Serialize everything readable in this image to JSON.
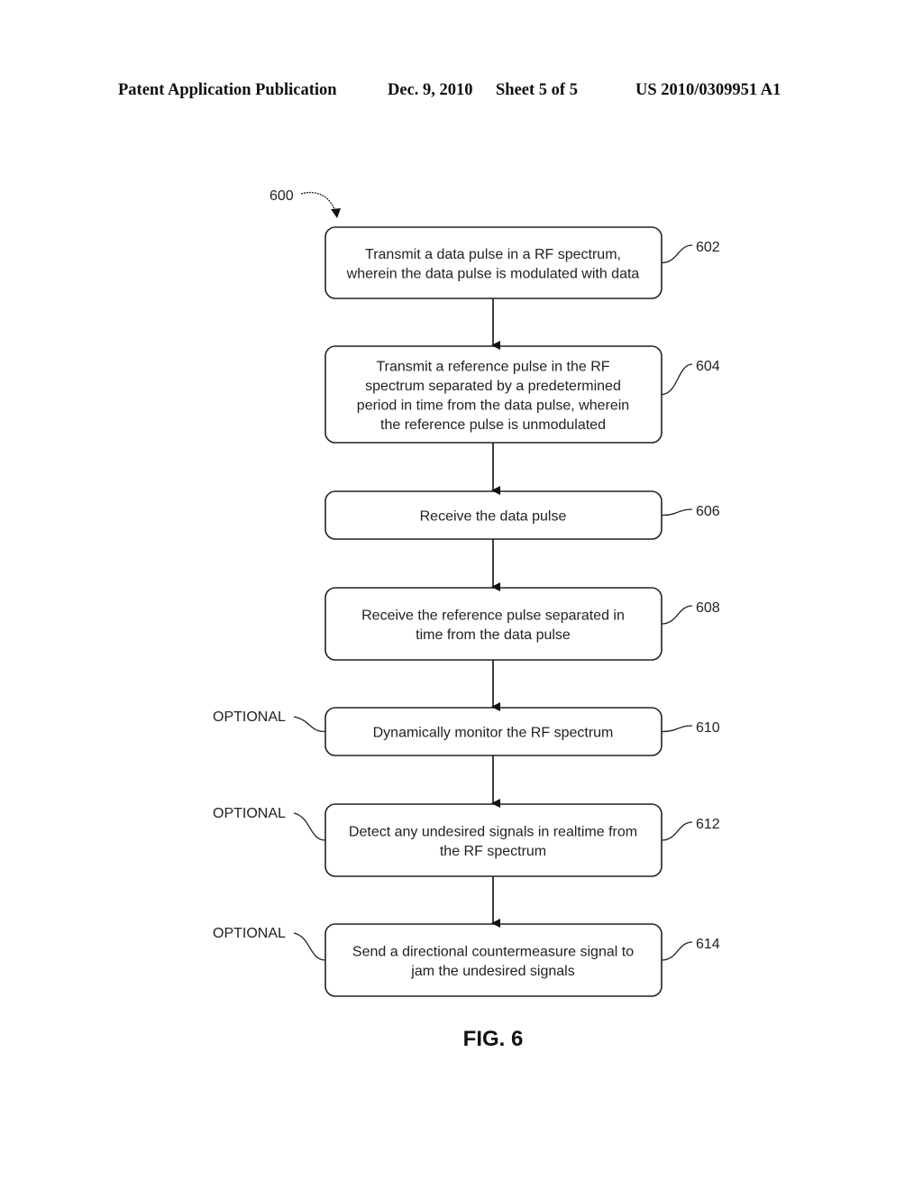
{
  "header": {
    "publication": "Patent Application Publication",
    "date": "Dec. 9, 2010",
    "sheet": "Sheet 5 of 5",
    "number": "US 2010/0309951 A1"
  },
  "diagram": {
    "figure_ref": "600",
    "figure_label": "FIG. 6",
    "optional_label": "OPTIONAL",
    "steps": [
      {
        "ref": "602",
        "optional": false,
        "lines": [
          "Transmit a data pulse in a RF spectrum,",
          "wherein the data pulse is modulated with data"
        ]
      },
      {
        "ref": "604",
        "optional": false,
        "lines": [
          "Transmit a reference pulse in the RF",
          "spectrum separated by a predetermined",
          "period in time from the data pulse, wherein",
          "the reference pulse is unmodulated"
        ]
      },
      {
        "ref": "606",
        "optional": false,
        "lines": [
          "Receive the data pulse"
        ]
      },
      {
        "ref": "608",
        "optional": false,
        "lines": [
          "Receive the reference pulse separated in",
          "time from the data pulse"
        ]
      },
      {
        "ref": "610",
        "optional": true,
        "lines": [
          "Dynamically monitor the RF spectrum"
        ]
      },
      {
        "ref": "612",
        "optional": true,
        "lines": [
          "Detect any undesired signals in realtime from",
          "the RF spectrum"
        ]
      },
      {
        "ref": "614",
        "optional": true,
        "lines": [
          "Send a directional countermeasure signal to",
          "jam the undesired signals"
        ]
      }
    ]
  }
}
